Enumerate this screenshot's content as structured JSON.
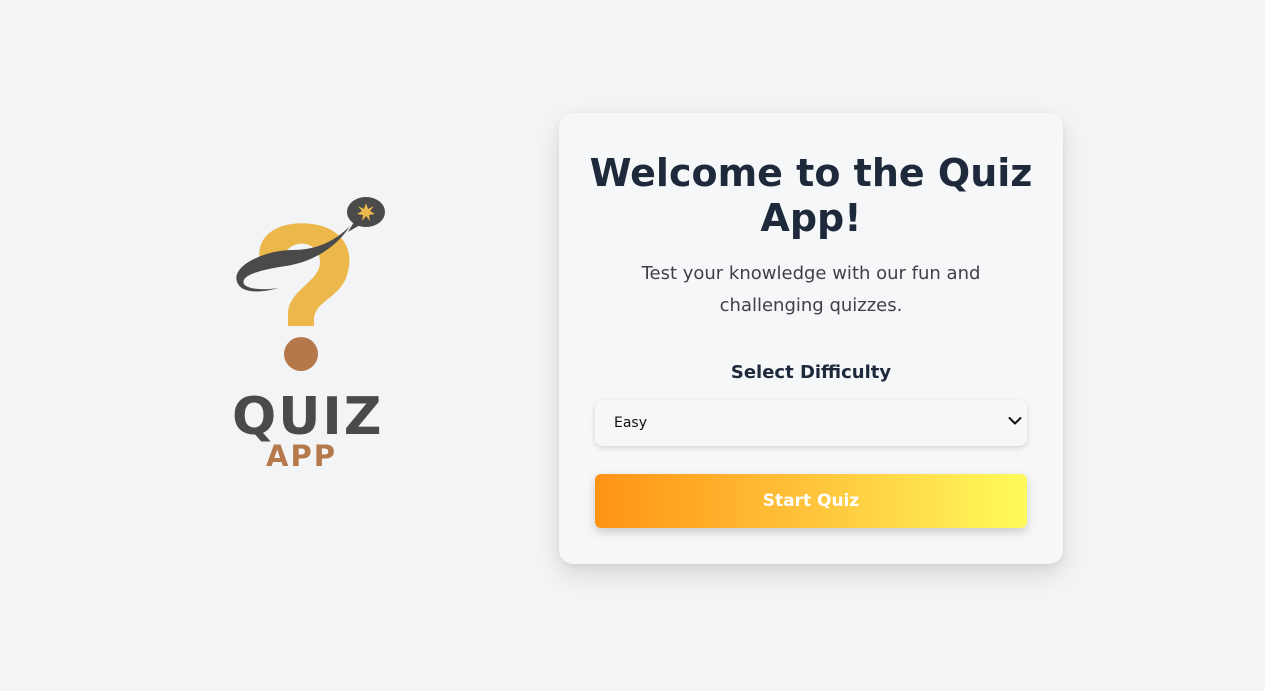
{
  "logo": {
    "word_top": "QUIZ",
    "word_bottom": "APP",
    "icon": "question-mark-speech-bubble-icon",
    "colors": {
      "question_mark": "#ecb84c",
      "dot": "#b5784a",
      "ring": "#4a4a4a",
      "bubble": "#4a4a4a",
      "sparkle": "#ecb84c"
    }
  },
  "card": {
    "title": "Welcome to the Quiz App!",
    "subtitle": "Test your knowledge with our fun and challenging quizzes.",
    "difficulty_label": "Select Difficulty",
    "difficulty": {
      "selected": "Easy",
      "icon": "chevron-down-icon"
    },
    "start_button_label": "Start Quiz"
  },
  "colors": {
    "background": "#f3f4f6",
    "card": "#f6f7f9",
    "title": "#1e293b",
    "button_gradient": [
      "#ff9314",
      "#ffc43c",
      "#fffb5c"
    ]
  }
}
